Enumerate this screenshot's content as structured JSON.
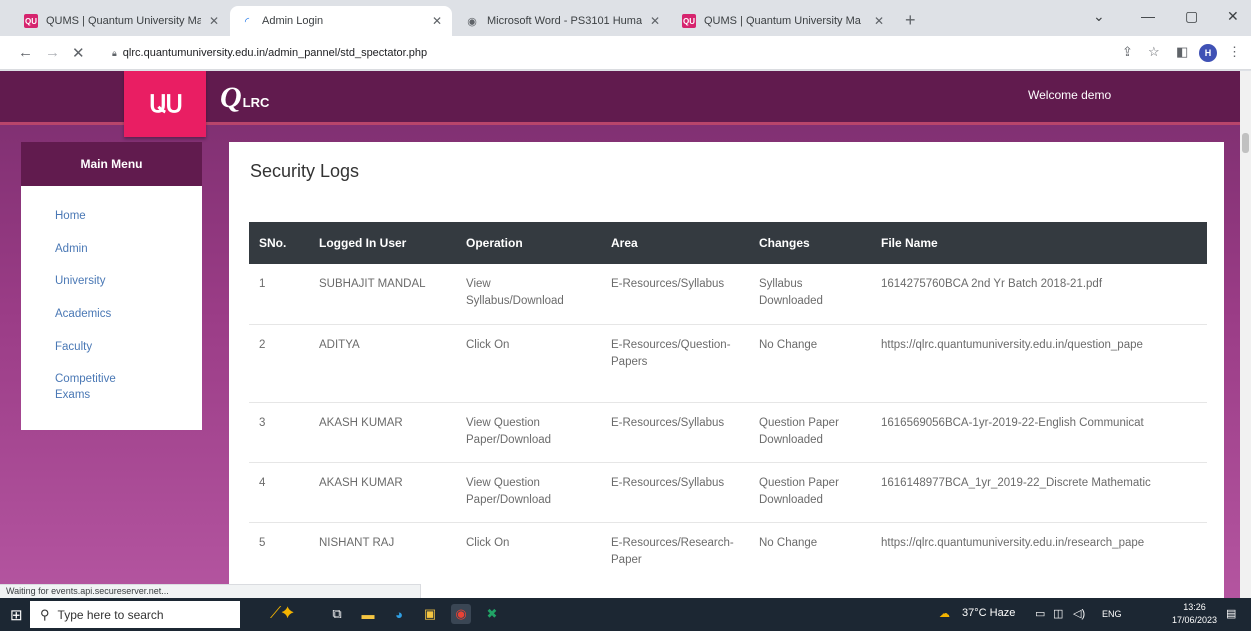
{
  "browser": {
    "tabs": [
      {
        "title": "QUMS | Quantum University Ma",
        "icon": "qums-favicon"
      },
      {
        "title": "Admin Login",
        "icon": "loading-icon"
      },
      {
        "title": "Microsoft Word - PS3101 Huma",
        "icon": "globe-icon"
      },
      {
        "title": "QUMS | Quantum University Ma",
        "icon": "qums-favicon"
      }
    ],
    "url": "qlrc.quantumuniversity.edu.in/admin_pannel/std_spectator.php",
    "profile_initial": "H",
    "status_text": "Waiting for events.api.secureserver.net..."
  },
  "header": {
    "logo_text": "ԱՍ",
    "brand_q": "Q",
    "brand_suffix": "LRC",
    "welcome": "Welcome demo"
  },
  "sidebar": {
    "title": "Main Menu",
    "items": [
      {
        "label": "Home"
      },
      {
        "label": "Admin"
      },
      {
        "label": "University"
      },
      {
        "label": "Academics"
      },
      {
        "label": "Faculty"
      },
      {
        "label": "Competitive Exams"
      }
    ]
  },
  "main": {
    "title": "Security Logs",
    "columns": [
      "SNo.",
      "Logged In User",
      "Operation",
      "Area",
      "Changes",
      "File Name"
    ],
    "rows": [
      {
        "sno": "1",
        "user": "SUBHAJIT MANDAL",
        "operation": "View Syllabus/Download",
        "area": "E-Resources/Syllabus",
        "changes": "Syllabus Downloaded",
        "file": "1614275760BCA 2nd Yr Batch 2018-21.pdf"
      },
      {
        "sno": "2",
        "user": "ADITYA",
        "operation": "Click On",
        "area": "E-Resources/Question-Papers",
        "changes": "No Change",
        "file": "https://qlrc.quantumuniversity.edu.in/question_pape"
      },
      {
        "sno": "3",
        "user": "AKASH KUMAR",
        "operation": "View Question Paper/Download",
        "area": "E-Resources/Syllabus",
        "changes": "Question Paper Downloaded",
        "file": "1616569056BCA-1yr-2019-22-English Communicat"
      },
      {
        "sno": "4",
        "user": "AKASH KUMAR",
        "operation": "View Question Paper/Download",
        "area": "E-Resources/Syllabus",
        "changes": "Question Paper Downloaded",
        "file": "1616148977BCA_1yr_2019-22_Discrete Mathematic"
      },
      {
        "sno": "5",
        "user": "NISHANT RAJ",
        "operation": "Click On",
        "area": "E-Resources/Research-Paper",
        "changes": "No Change",
        "file": "https://qlrc.quantumuniversity.edu.in/research_pape"
      }
    ]
  },
  "taskbar": {
    "search_placeholder": "Type here to search",
    "weather": "37°C Haze",
    "language": "ENG",
    "time": "13:26",
    "date": "17/06/2023"
  },
  "colors": {
    "header_bg": "#611b4e",
    "logo_bg": "#e91e63",
    "table_head": "#343a40",
    "menu_link": "#4a78b5"
  }
}
